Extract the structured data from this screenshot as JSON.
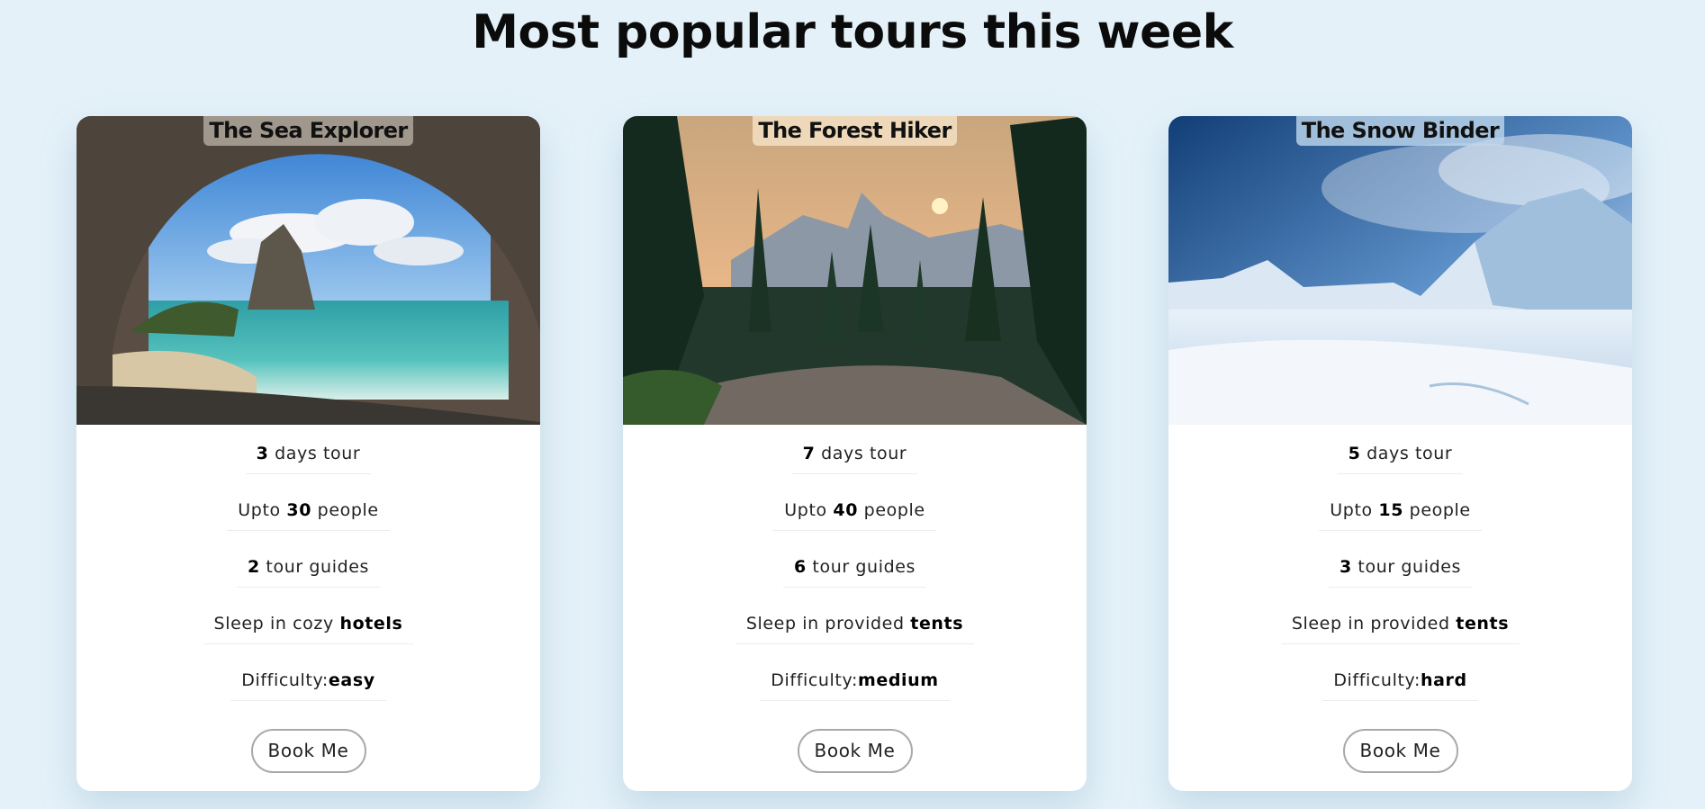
{
  "page": {
    "heading": "Most popular tours this week"
  },
  "tours": [
    {
      "name": "The Sea Explorer",
      "days": "3",
      "days_suffix": " days tour",
      "people_prefix": "Upto ",
      "people": "30",
      "people_suffix": " people",
      "guides": "2",
      "guides_suffix": " tour guides",
      "sleep_prefix": "Sleep in cozy ",
      "sleep": "hotels",
      "difficulty_label": "Difficulty:",
      "difficulty": "easy",
      "button": "Book Me",
      "image_icon": "sea-cave-photo"
    },
    {
      "name": "The Forest Hiker",
      "days": "7",
      "days_suffix": " days tour",
      "people_prefix": "Upto ",
      "people": "40",
      "people_suffix": " people",
      "guides": "6",
      "guides_suffix": " tour guides",
      "sleep_prefix": "Sleep in provided ",
      "sleep": "tents",
      "difficulty_label": "Difficulty:",
      "difficulty": "medium",
      "button": "Book Me",
      "image_icon": "forest-sunset-photo"
    },
    {
      "name": "The Snow Binder",
      "days": "5",
      "days_suffix": " days tour",
      "people_prefix": "Upto ",
      "people": "15",
      "people_suffix": " people",
      "guides": "3",
      "guides_suffix": " tour guides",
      "sleep_prefix": "Sleep in provided ",
      "sleep": "tents",
      "difficulty_label": "Difficulty:",
      "difficulty": "hard",
      "button": "Book Me",
      "image_icon": "snowy-mountain-photo"
    }
  ],
  "colors": {
    "background": "#e4f1f9",
    "card": "#ffffff",
    "button_border": "#a9a9a9"
  }
}
